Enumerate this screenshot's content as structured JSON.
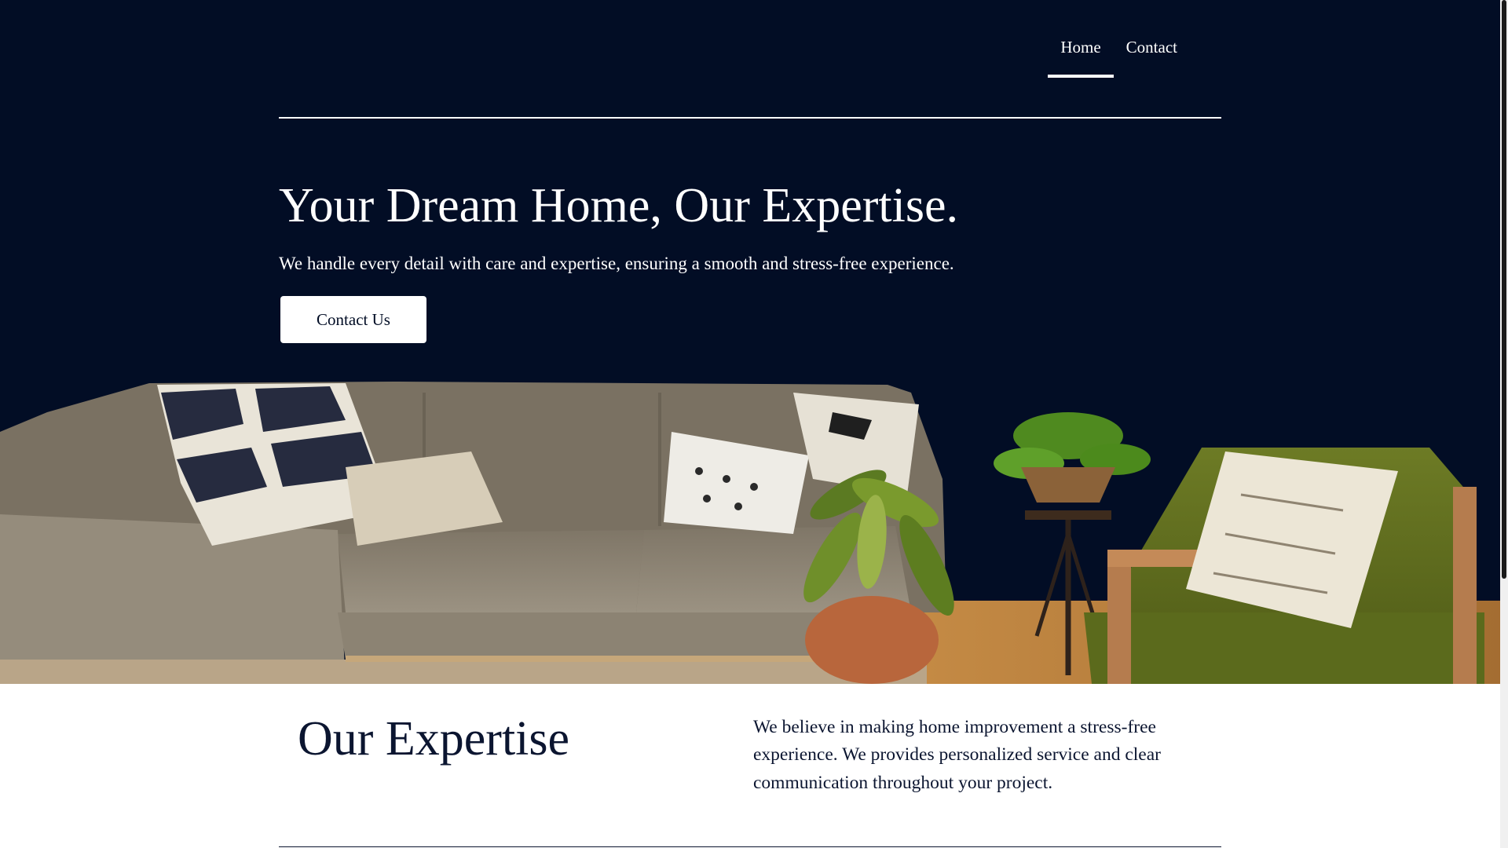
{
  "nav": {
    "items": [
      {
        "label": "Home",
        "active": true
      },
      {
        "label": "Contact",
        "active": false
      }
    ]
  },
  "hero": {
    "title": "Your Dream Home, Our Expertise.",
    "subtitle": "We handle every detail with care and expertise, ensuring a smooth and stress-free experience.",
    "cta_label": "Contact Us",
    "background_color": "#020d25"
  },
  "expertise": {
    "title": "Our Expertise",
    "text": "We believe in making home improvement a stress-free experience. We provides personalized service and clear communication throughout your project."
  },
  "colors": {
    "navy": "#020d25",
    "text_dark": "#0b1530",
    "white": "#ffffff",
    "sofa": "#8a8070",
    "armchair_green": "#5d6b1e",
    "floor_wood": "#b07a3a"
  }
}
